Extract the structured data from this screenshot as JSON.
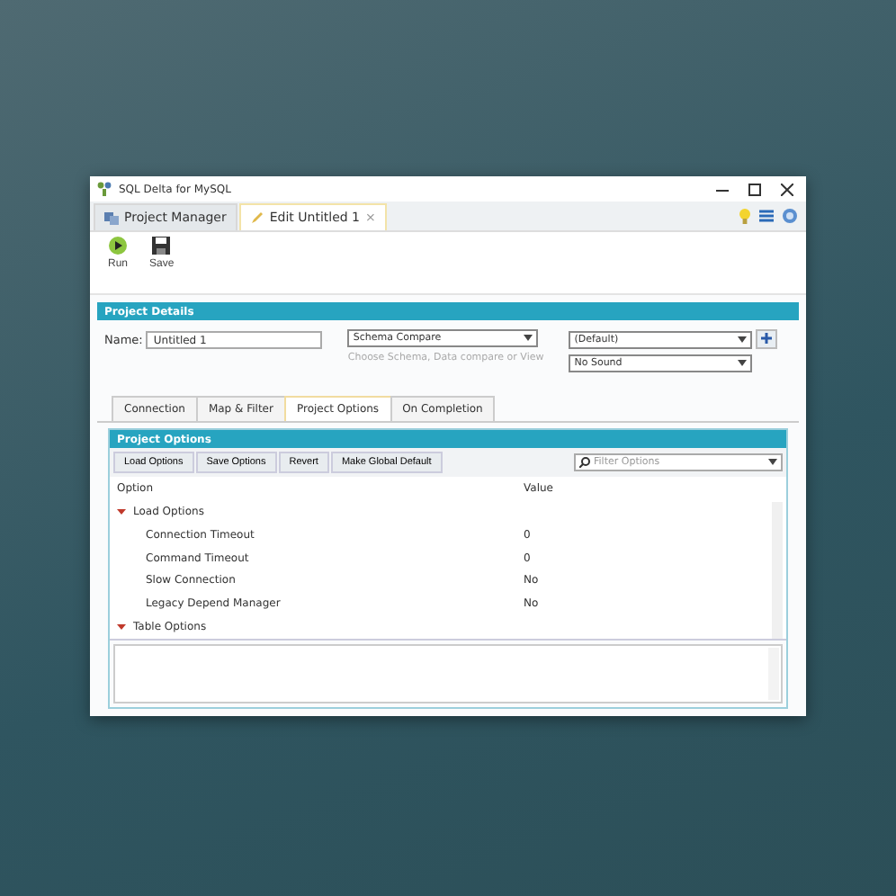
{
  "window": {
    "title": "SQL Delta for MySQL"
  },
  "tabs": [
    {
      "label": "Project Manager",
      "selected": false,
      "kind": "manager"
    },
    {
      "label": "Edit Untitled 1",
      "selected": true,
      "kind": "editor",
      "close": "×"
    }
  ],
  "toolbar": [
    {
      "label": "Run",
      "kind": "run"
    },
    {
      "label": "Save",
      "kind": "save"
    }
  ],
  "project_details": {
    "title": "Project Details",
    "name_label": "Name:",
    "name_value": "Untitled 1",
    "compare_type": "Schema Compare",
    "compare_hint": "Choose Schema, Data compare or View",
    "profile": "(Default)",
    "sound": "No Sound"
  },
  "section_tabs": [
    {
      "label": "Connection",
      "selected": false
    },
    {
      "label": "Map & Filter",
      "selected": false
    },
    {
      "label": "Project Options",
      "selected": true
    },
    {
      "label": "On Completion",
      "selected": false
    }
  ],
  "project_options": {
    "title": "Project Options",
    "buttons": [
      "Load Options",
      "Save Options",
      "Revert",
      "Make Global Default"
    ],
    "filter": {
      "placeholder": "Filter Options"
    },
    "columns": [
      "Option",
      "Value"
    ],
    "tree": [
      {
        "label": "Load Options",
        "expanded": true,
        "children": [
          {
            "label": "Connection Timeout",
            "value": "0"
          },
          {
            "label": "Command Timeout",
            "value": "0"
          },
          {
            "label": "Slow Connection",
            "value": "No"
          },
          {
            "label": "Legacy Depend Manager",
            "value": "No"
          }
        ]
      },
      {
        "label": "Table Options",
        "expanded": true
      }
    ]
  }
}
